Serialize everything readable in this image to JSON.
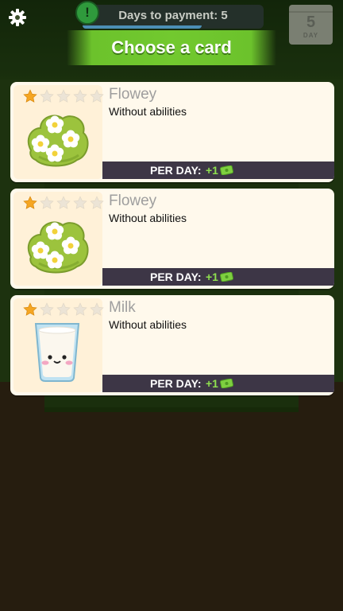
{
  "hud": {
    "days_to_payment": "Days to payment: 5",
    "days_progress": 0.66,
    "alert_symbol": "!",
    "calendar_day": "5",
    "calendar_label": "DAY",
    "icons": [
      "gear-icon",
      "alert-icon",
      "calendar-icon"
    ]
  },
  "banner": {
    "title": "Choose a card"
  },
  "colors": {
    "banner_green": "#72c92f",
    "income_green": "#8fe04f",
    "star_gold": "#f5a623",
    "per_day_bar": "#3d3646"
  },
  "cards": [
    {
      "name": "Flowey",
      "description": "Without abilities",
      "stars_filled": 1,
      "stars_total": 5,
      "illustration": "flower-bush",
      "per_day_label": "PER DAY:",
      "per_day_value": "+1"
    },
    {
      "name": "Flowey",
      "description": "Without abilities",
      "stars_filled": 1,
      "stars_total": 5,
      "illustration": "flower-bush",
      "per_day_label": "PER DAY:",
      "per_day_value": "+1"
    },
    {
      "name": "Milk",
      "description": "Without abilities",
      "stars_filled": 1,
      "stars_total": 5,
      "illustration": "milk-glass",
      "per_day_label": "PER DAY:",
      "per_day_value": "+1"
    }
  ]
}
